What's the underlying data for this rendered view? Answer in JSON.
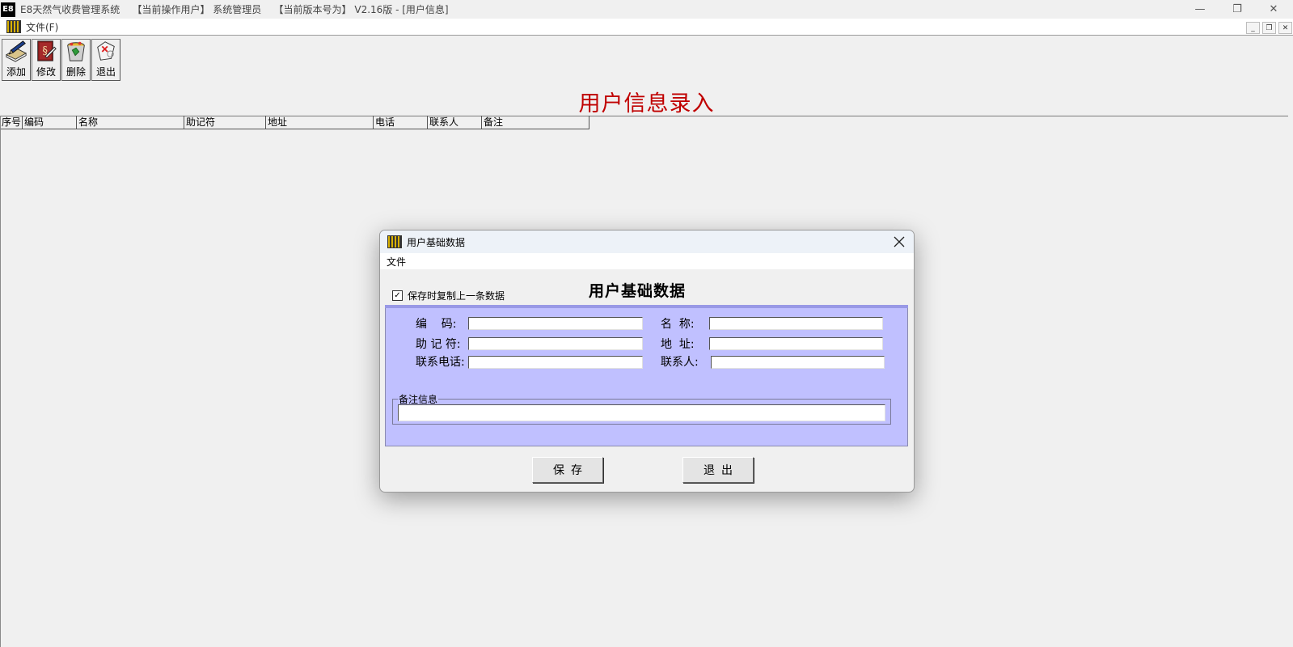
{
  "window": {
    "logo": "E8",
    "title": "E8天然气收费管理系统    【当前操作用户】 系统管理员    【当前版本号为】 V2.16版 - [用户信息]",
    "minimize": "—",
    "maximize": "❐",
    "close": "✕"
  },
  "menubar": {
    "file": "文件(F)"
  },
  "mdi_controls": {
    "minimize": "_",
    "restore": "❐",
    "close": "✕"
  },
  "toolbar": [
    {
      "label": "添加",
      "icon": "add-book-icon"
    },
    {
      "label": "修改",
      "icon": "edit-book-icon"
    },
    {
      "label": "删除",
      "icon": "recycle-bin-icon"
    },
    {
      "label": "退出",
      "icon": "exit-icon"
    }
  ],
  "page_title": "用户信息录入",
  "grid": {
    "columns": [
      "序号",
      "编码",
      "名称",
      "助记符",
      "地址",
      "电话",
      "联系人",
      "备注"
    ]
  },
  "dialog": {
    "title": "用户基础数据",
    "menu_file": "文件",
    "copy_last_checked": true,
    "copy_last_label": "保存时复制上一条数据",
    "heading": "用户基础数据",
    "fields": {
      "code_label": "编    码:",
      "name_label": "名  称:",
      "mnemonic_label": "助 记 符:",
      "address_label": "地  址:",
      "phone_label": "联系电话:",
      "contact_label": "联系人:",
      "code": "",
      "name": "",
      "mnemonic": "",
      "address": "",
      "phone": "",
      "contact": ""
    },
    "remark_label": "备注信息",
    "remark": "",
    "save_label": "保存",
    "exit_label": "退出"
  },
  "colors": {
    "title_red": "#c00000",
    "form_panel_bg": "#c0c0ff",
    "app_bg": "#f0f0f0"
  }
}
